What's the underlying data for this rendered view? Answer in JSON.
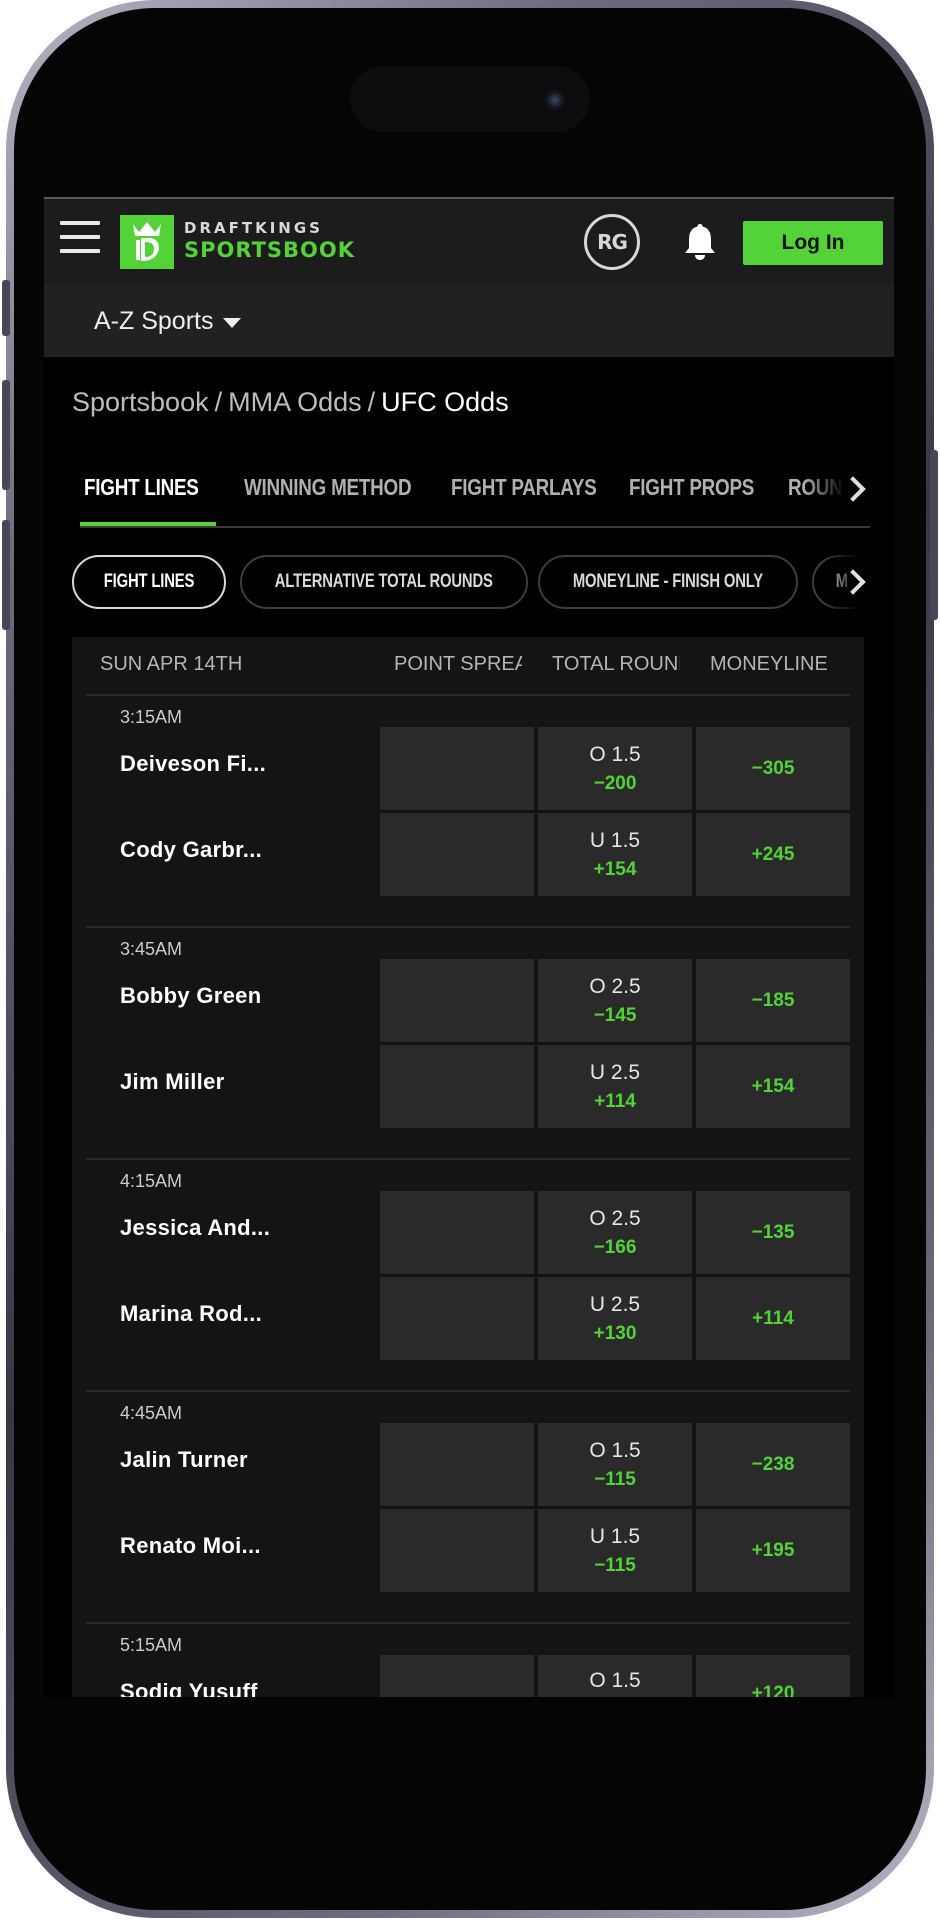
{
  "header": {
    "brand_line1": "DRAFTKINGS",
    "brand_line2": "SPORTSBOOK",
    "rg_label": "RG",
    "login_label": "Log In"
  },
  "sports_menu": {
    "label": "A-Z Sports"
  },
  "breadcrumb": {
    "items": [
      "Sportsbook",
      "MMA Odds",
      "UFC Odds"
    ],
    "separator": "/"
  },
  "main_tabs": [
    {
      "label": "FIGHT LINES",
      "active": true
    },
    {
      "label": "WINNING METHOD",
      "active": false
    },
    {
      "label": "FIGHT PARLAYS",
      "active": false
    },
    {
      "label": "FIGHT PROPS",
      "active": false
    },
    {
      "label": "ROUND",
      "active": false
    }
  ],
  "filter_pills": [
    {
      "label": "FIGHT LINES",
      "active": true
    },
    {
      "label": "ALTERNATIVE TOTAL ROUNDS",
      "active": false
    },
    {
      "label": "MONEYLINE - FINISH ONLY",
      "active": false
    },
    {
      "label": "M",
      "active": false
    }
  ],
  "table": {
    "date_header": "SUN APR 14TH",
    "columns": [
      "POINT SPREAD",
      "TOTAL ROUNDS",
      "MONEYLINE"
    ],
    "events": [
      {
        "time": "3:15AM",
        "fighters": [
          {
            "name": "Deiveson Fi...",
            "total_line": "O 1.5",
            "total_odds": "−200",
            "moneyline": "−305"
          },
          {
            "name": "Cody Garbr...",
            "total_line": "U 1.5",
            "total_odds": "+154",
            "moneyline": "+245"
          }
        ]
      },
      {
        "time": "3:45AM",
        "fighters": [
          {
            "name": "Bobby Green",
            "total_line": "O 2.5",
            "total_odds": "−145",
            "moneyline": "−185"
          },
          {
            "name": "Jim Miller",
            "total_line": "U 2.5",
            "total_odds": "+114",
            "moneyline": "+154"
          }
        ]
      },
      {
        "time": "4:15AM",
        "fighters": [
          {
            "name": "Jessica And...",
            "total_line": "O 2.5",
            "total_odds": "−166",
            "moneyline": "−135"
          },
          {
            "name": "Marina Rod...",
            "total_line": "U 2.5",
            "total_odds": "+130",
            "moneyline": "+114"
          }
        ]
      },
      {
        "time": "4:45AM",
        "fighters": [
          {
            "name": "Jalin Turner",
            "total_line": "O 1.5",
            "total_odds": "−115",
            "moneyline": "−238"
          },
          {
            "name": "Renato Moi...",
            "total_line": "U 1.5",
            "total_odds": "−115",
            "moneyline": "+195"
          }
        ]
      },
      {
        "time": "5:15AM",
        "fighters": [
          {
            "name": "Sodiq Yusuff",
            "total_line": "O 1.5",
            "total_odds": "",
            "moneyline": "+120"
          }
        ]
      }
    ]
  },
  "colors": {
    "accent": "#53d337",
    "header_bg": "#1c1c1c",
    "cell_bg": "#2a2a2a",
    "page_bg": "#000000"
  },
  "icons": [
    "menu-icon",
    "draftkings-logo-icon",
    "rg-icon",
    "bell-icon",
    "chevron-right-icon",
    "caret-down-icon"
  ]
}
